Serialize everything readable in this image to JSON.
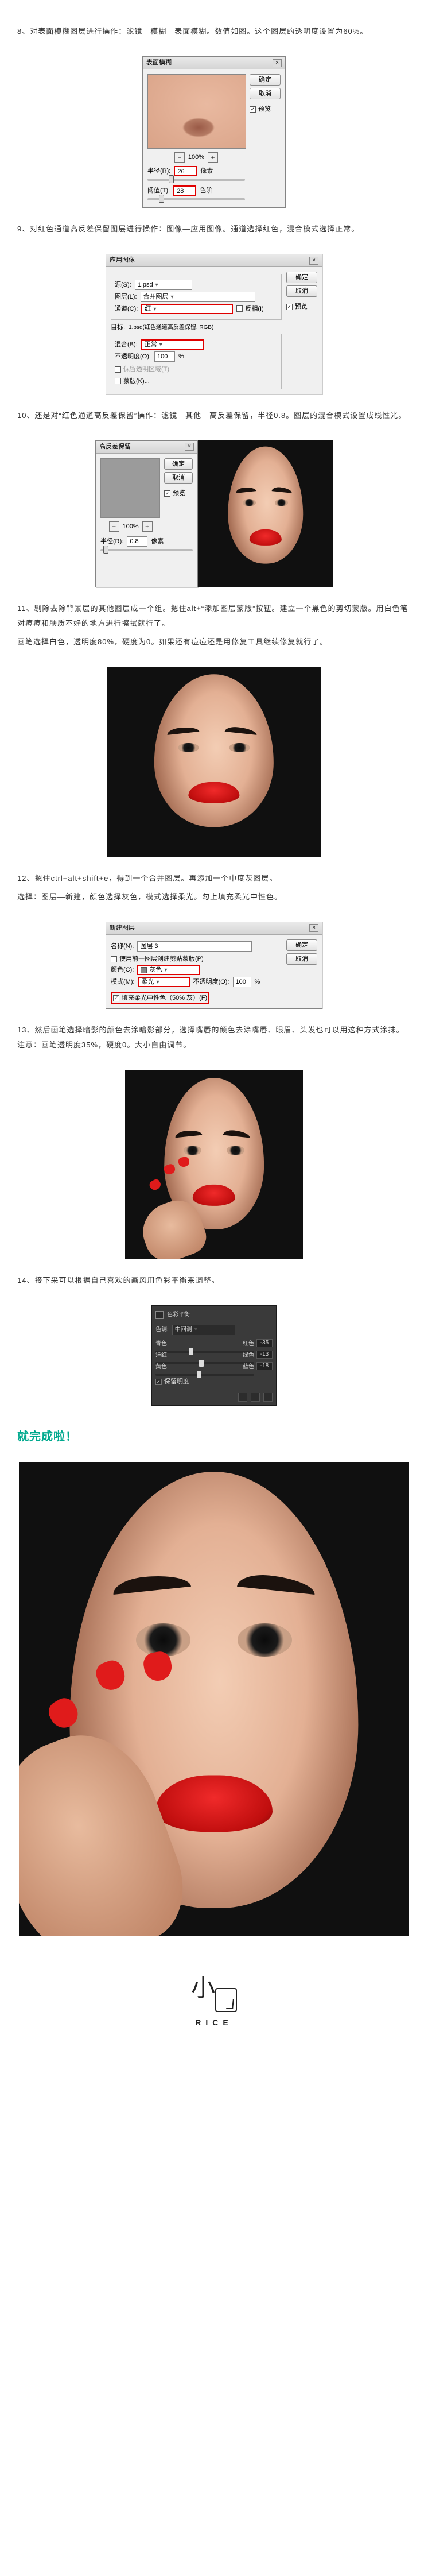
{
  "step8": {
    "text": "8、对表面模糊图层进行操作：滤镜—模糊—表面模糊。数值如图。这个图层的透明度设置为60%。",
    "dialog": {
      "title": "表面模糊",
      "ok": "确定",
      "cancel": "取消",
      "preview_cb": "预览",
      "zoom": "100%",
      "radius_label": "半径(R):",
      "radius_value": "26",
      "radius_unit": "像素",
      "threshold_label": "阈值(T):",
      "threshold_value": "28",
      "threshold_unit": "色阶"
    }
  },
  "step9": {
    "text": "9、对红色通道高反差保留图层进行操作：图像—应用图像。通道选择红色，混合模式选择正常。",
    "dialog": {
      "title": "应用图像",
      "ok": "确定",
      "cancel": "取消",
      "preview_cb": "预览",
      "source_label": "源(S):",
      "source_value": "1.psd",
      "layer_label": "图层(L):",
      "layer_value": "合并图层",
      "channel_label": "通道(C):",
      "channel_value": "红",
      "invert_cb": "反相(I)",
      "target_label": "目标:",
      "target_value": "1.psd(红色通道高反差保留, RGB)",
      "blend_label": "混合(B):",
      "blend_value": "正常",
      "opacity_label": "不透明度(O):",
      "opacity_value": "100",
      "opacity_unit": "%",
      "preserve_trans": "保留透明区域(T)",
      "mask_cb": "蒙版(K)..."
    }
  },
  "step10": {
    "text": "10、还是对“红色通道高反差保留”操作：滤镜—其他—高反差保留，半径0.8。图层的混合模式设置成线性光。",
    "dialog": {
      "title": "高反差保留",
      "ok": "确定",
      "cancel": "取消",
      "preview_cb": "预览",
      "zoom": "100%",
      "radius_label": "半径(R):",
      "radius_value": "0.8",
      "radius_unit": "像素"
    }
  },
  "step11": {
    "text_a": "11、剔除去除背景层的其他图层成一个组。摁住alt+“添加图层蒙版”按钮。建立一个黑色的剪切蒙版。用白色笔对痘痘和肤质不好的地方进行擦拭就行了。",
    "text_b": "画笔选择白色，透明度80%，硬度为0。如果还有痘痘还是用修复工具继续修复就行了。"
  },
  "step12": {
    "text_a": "12、摁住ctrl+alt+shift+e，得到一个合并图层。再添加一个中度灰图层。",
    "text_b": "选择：图层—新建，颜色选择灰色，模式选择柔光。勾上填充柔光中性色。",
    "dialog": {
      "title": "新建图层",
      "ok": "确定",
      "cancel": "取消",
      "name_label": "名称(N):",
      "name_value": "图层 3",
      "clip_cb": "使用前一图层创建剪贴蒙版(P)",
      "color_label": "颜色(C):",
      "color_value": "灰色",
      "mode_label": "模式(M):",
      "mode_value": "柔光",
      "opacity_label": "不透明度(O):",
      "opacity_value": "100",
      "opacity_unit": "%",
      "fill_neutral": "填充柔光中性色（50% 灰）(F)"
    }
  },
  "step13": {
    "text": "13、然后画笔选择暗影的颜色去涂暗影部分，选择嘴唇的颜色去涂嘴唇、眼眉、头发也可以用这种方式涂抹。注意：画笔透明度35%，硬度0。大小自由调节。"
  },
  "step14": {
    "text": "14、接下来可以根据自己喜欢的画风用色彩平衡来调整。",
    "panel": {
      "title": "色彩平衡",
      "tone_label": "色调:",
      "tone_value": "中间调",
      "cyan": "青色",
      "red": "红色",
      "magenta": "洋红",
      "green": "绿色",
      "yellow": "黄色",
      "blue": "蓝色",
      "v1": "-35",
      "v2": "-13",
      "v3": "-18",
      "preserve_lum": "保留明度"
    }
  },
  "finish": "就完成啦！",
  "brand": {
    "mark": "小月",
    "rice": "RICE"
  }
}
